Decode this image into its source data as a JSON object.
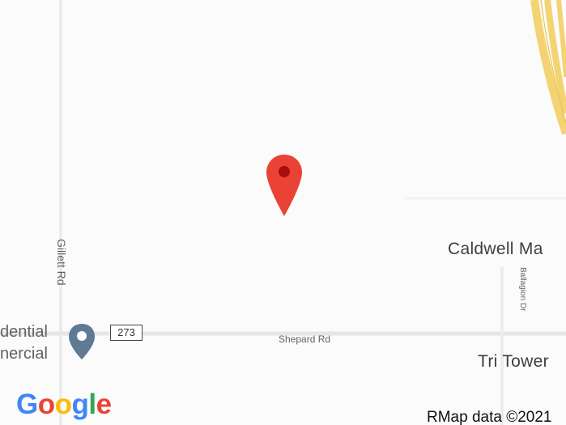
{
  "map": {
    "roads": {
      "gillett": "Gillett Rd",
      "shepard": "Shepard Rd",
      "ballagion": "Ballagion Dr",
      "route_shield": "273"
    },
    "places": {
      "caldwell": "Caldwell Ma",
      "tri_tower": "Tri Tower",
      "business_line1": "dential",
      "business_line2": "nercial"
    },
    "logo": {
      "letters": [
        "G",
        "o",
        "o",
        "g",
        "l",
        "e"
      ],
      "colors": [
        "#4285F4",
        "#EA4335",
        "#FBBC05",
        "#4285F4",
        "#34A853",
        "#EA4335"
      ]
    },
    "attribution": "RMap data ©2021",
    "colors": {
      "marker": "#EA4335",
      "marker_dot": "#A50E0E",
      "poi_pin": "#5F7A94",
      "highway": "#F3D372"
    }
  }
}
